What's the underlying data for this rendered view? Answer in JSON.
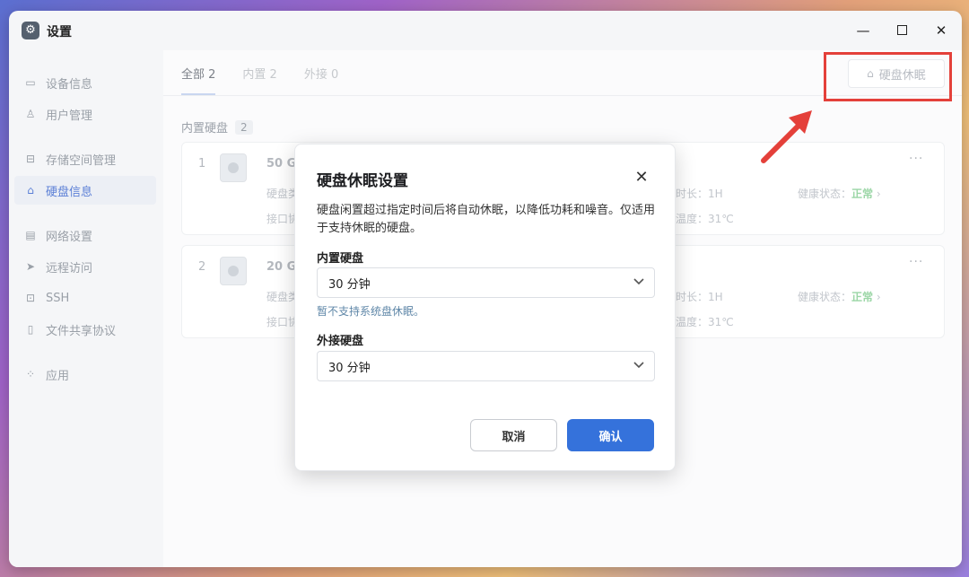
{
  "window": {
    "title": "设置",
    "controls": {
      "minimize": "—",
      "close": "✕"
    }
  },
  "sidebar": {
    "items": [
      {
        "label": "设备信息",
        "icon": "device-info-icon"
      },
      {
        "label": "用户管理",
        "icon": "user-icon"
      },
      {
        "label": "存储空间管理",
        "icon": "storage-icon"
      },
      {
        "label": "硬盘信息",
        "icon": "disk-icon",
        "active": true
      },
      {
        "label": "网络设置",
        "icon": "network-icon"
      },
      {
        "label": "远程访问",
        "icon": "remote-icon"
      },
      {
        "label": "SSH",
        "icon": "terminal-icon"
      },
      {
        "label": "文件共享协议",
        "icon": "file-share-icon"
      },
      {
        "label": "应用",
        "icon": "apps-icon"
      }
    ]
  },
  "main": {
    "tabs": [
      {
        "label": "全部 2",
        "active": true
      },
      {
        "label": "内置 2"
      },
      {
        "label": "外接 0"
      }
    ],
    "sleep_button": "硬盘休眠",
    "section_title": "内置硬盘",
    "section_count": "2",
    "disks": [
      {
        "index": "1",
        "size": "50 GB",
        "type_label": "硬盘类",
        "iface_label": "接口协",
        "runtime": "用时长：1H",
        "temp": "前温度：31℃",
        "health_label": "健康状态：",
        "health_value": "正常",
        "more": "···"
      },
      {
        "index": "2",
        "size": "20 GB",
        "type_label": "硬盘类",
        "iface_label": "接口协",
        "runtime": "用时长：1H",
        "temp": "前温度：31℃",
        "health_label": "健康状态：",
        "health_value": "正常",
        "more": "···"
      }
    ]
  },
  "dialog": {
    "title": "硬盘休眠设置",
    "description": "硬盘闲置超过指定时间后将自动休眠，以降低功耗和噪音。仅适用于支持休眠的硬盘。",
    "internal_label": "内置硬盘",
    "internal_value": "30 分钟",
    "internal_hint": "暂不支持系统盘休眠。",
    "external_label": "外接硬盘",
    "external_value": "30 分钟",
    "cancel": "取消",
    "confirm": "确认"
  },
  "colors": {
    "primary": "#3572db",
    "health_ok": "#9bd6a6",
    "highlight": "#e4403a",
    "hint": "#5f87a8"
  }
}
